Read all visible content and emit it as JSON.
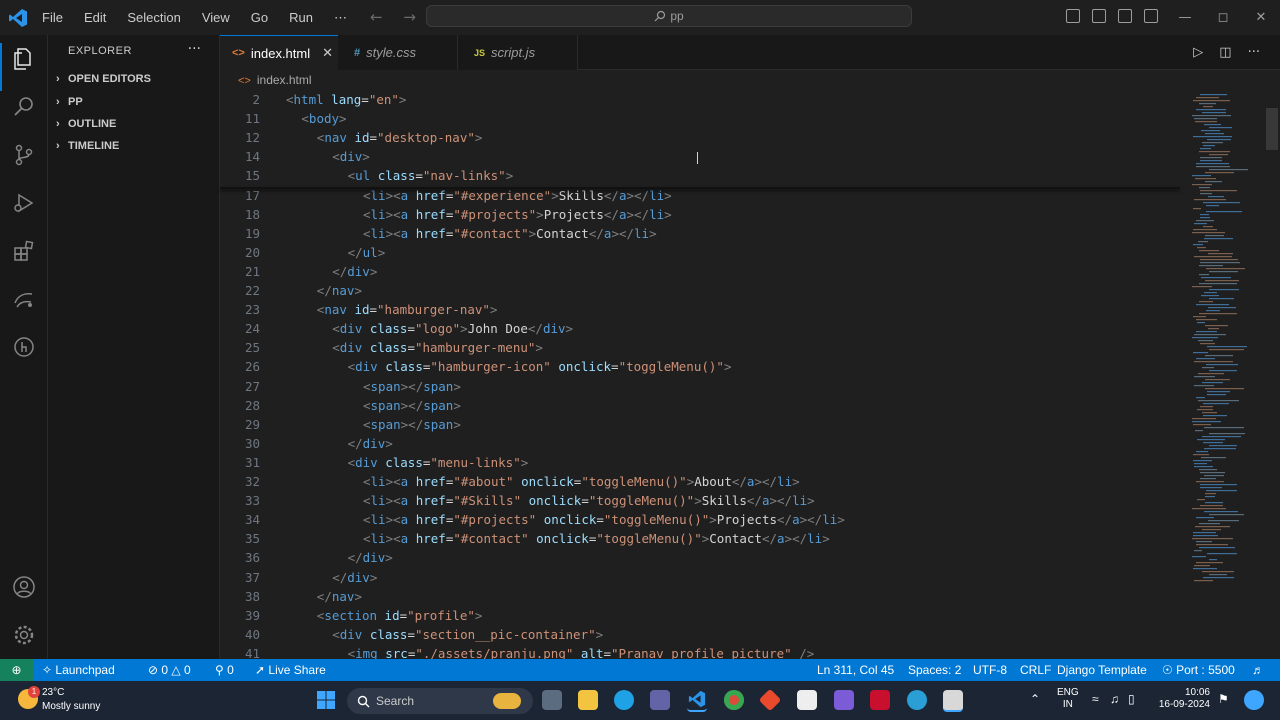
{
  "menu": [
    "File",
    "Edit",
    "Selection",
    "View",
    "Go",
    "Run",
    "⋯"
  ],
  "command_center": {
    "text": "pp"
  },
  "sidebar": {
    "title": "EXPLORER",
    "sections": [
      "OPEN EDITORS",
      "PP",
      "OUTLINE",
      "TIMELINE"
    ]
  },
  "tabs": [
    {
      "label": "index.html",
      "icon": "<>",
      "active": true
    },
    {
      "label": "style.css",
      "icon": "#",
      "active": false
    },
    {
      "label": "script.js",
      "icon": "JS",
      "active": false
    }
  ],
  "breadcrumb": "index.html",
  "code": [
    {
      "n": "2",
      "indent": 0,
      "text": "<html lang=\"en\">"
    },
    {
      "n": "11",
      "indent": 1,
      "text": "<body>"
    },
    {
      "n": "12",
      "indent": 2,
      "text": "<nav id=\"desktop-nav\">"
    },
    {
      "n": "14",
      "indent": 3,
      "text": "<div>"
    },
    {
      "n": "15",
      "indent": 4,
      "text": "<ul class=\"nav-links\">"
    },
    {
      "n": "17",
      "indent": 5,
      "text": "<li><a href=\"#experience\">Skills</a></li>"
    },
    {
      "n": "18",
      "indent": 5,
      "text": "<li><a href=\"#projects\">Projects</a></li>"
    },
    {
      "n": "19",
      "indent": 5,
      "text": "<li><a href=\"#contact\">Contact</a></li>"
    },
    {
      "n": "20",
      "indent": 4,
      "text": "</ul>"
    },
    {
      "n": "21",
      "indent": 3,
      "text": "</div>"
    },
    {
      "n": "22",
      "indent": 2,
      "text": "</nav>"
    },
    {
      "n": "23",
      "indent": 2,
      "text": "<nav id=\"hamburger-nav\">"
    },
    {
      "n": "24",
      "indent": 3,
      "text": "<div class=\"logo\">John Doe</div>"
    },
    {
      "n": "25",
      "indent": 3,
      "text": "<div class=\"hamburger-menu\">"
    },
    {
      "n": "26",
      "indent": 4,
      "text": "<div class=\"hamburger-icon\" onclick=\"toggleMenu()\">"
    },
    {
      "n": "27",
      "indent": 5,
      "text": "<span></span>"
    },
    {
      "n": "28",
      "indent": 5,
      "text": "<span></span>"
    },
    {
      "n": "29",
      "indent": 5,
      "text": "<span></span>"
    },
    {
      "n": "30",
      "indent": 4,
      "text": "</div>"
    },
    {
      "n": "31",
      "indent": 4,
      "text": "<div class=\"menu-links\">"
    },
    {
      "n": "32",
      "indent": 5,
      "text": "<li><a href=\"#about\" onclick=\"toggleMenu()\">About</a></li>"
    },
    {
      "n": "33",
      "indent": 5,
      "text": "<li><a href=\"#Skills\" onclick=\"toggleMenu()\">Skills</a></li>"
    },
    {
      "n": "34",
      "indent": 5,
      "text": "<li><a href=\"#projects\" onclick=\"toggleMenu()\">Projects</a></li>"
    },
    {
      "n": "35",
      "indent": 5,
      "text": "<li><a href=\"#contact\" onclick=\"toggleMenu()\">Contact</a></li>"
    },
    {
      "n": "36",
      "indent": 4,
      "text": "</div>"
    },
    {
      "n": "37",
      "indent": 3,
      "text": "</div>"
    },
    {
      "n": "38",
      "indent": 2,
      "text": "</nav>"
    },
    {
      "n": "39",
      "indent": 2,
      "text": "<section id=\"profile\">"
    },
    {
      "n": "40",
      "indent": 3,
      "text": "<div class=\"section__pic-container\">"
    },
    {
      "n": "41",
      "indent": 4,
      "text": "<img src=\"./assets/pranju.png\" alt=\"Pranav profile picture\" />"
    }
  ],
  "status": {
    "launchpad": "Launchpad",
    "errors": "0",
    "warnings": "0",
    "ports_forwarded": "0",
    "live_share": "Live Share",
    "cursor": "Ln 311, Col 45",
    "spaces": "Spaces: 2",
    "encoding": "UTF-8",
    "eol": "CRLF",
    "language": "Django Template",
    "port": "Port : 5500"
  },
  "taskbar": {
    "temperature": "23°C",
    "weather": "Mostly sunny",
    "weather_badge": "1",
    "search": "Search",
    "lang": "ENG",
    "region": "IN",
    "time": "10:06",
    "date": "16-09-2024"
  },
  "colors": {
    "accent": "#0078d4",
    "statusbar": "#0078d4",
    "remote": "#16825d",
    "tag": "#569cd6",
    "attr": "#9cdcfe",
    "value": "#ce9178"
  }
}
